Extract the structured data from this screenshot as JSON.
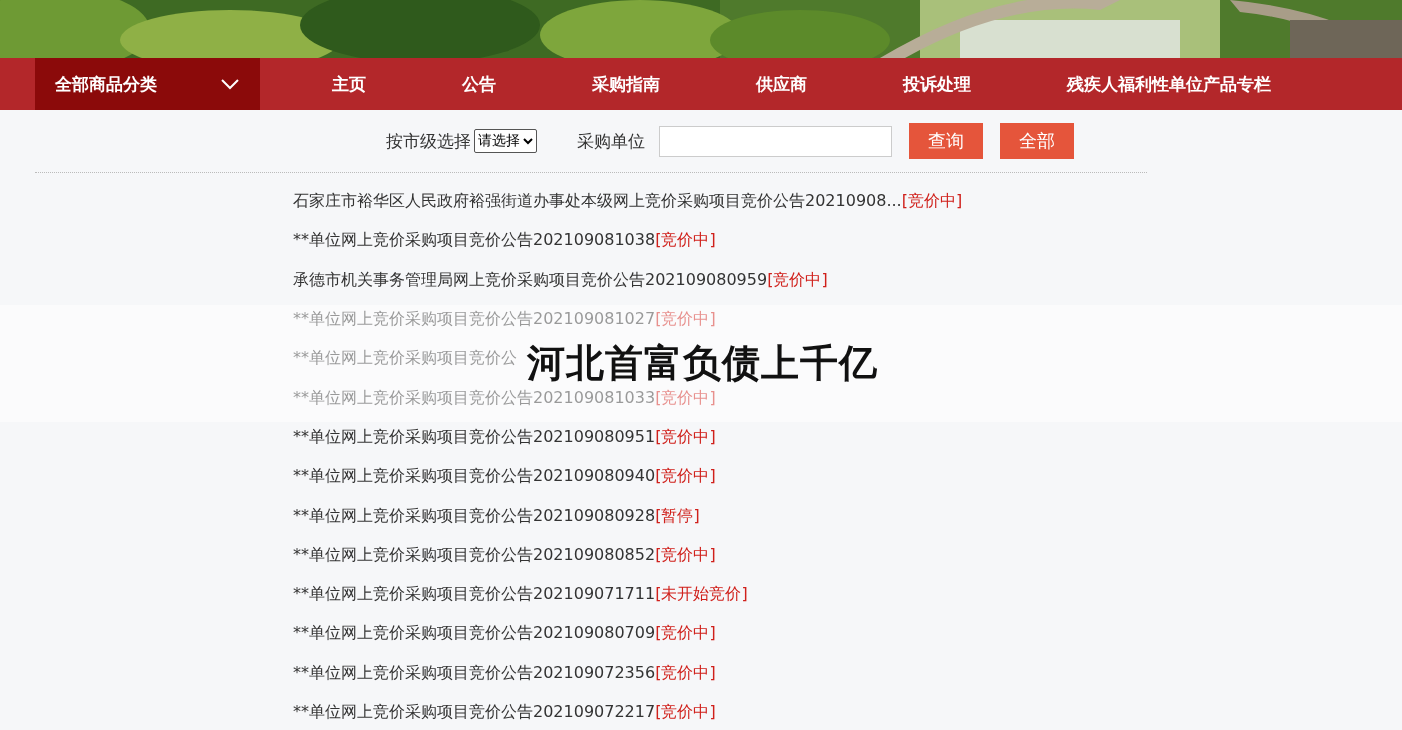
{
  "nav": {
    "category": {
      "label": "全部商品分类"
    },
    "items": [
      {
        "label": "主页"
      },
      {
        "label": "公告"
      },
      {
        "label": "采购指南"
      },
      {
        "label": "供应商"
      },
      {
        "label": "投诉处理"
      },
      {
        "label": "残疾人福利性单位产品专栏"
      }
    ]
  },
  "search": {
    "city_label": "按市级选择",
    "city_select": "请选择",
    "unit_label": "采购单位",
    "buttons": [
      "查询",
      "全部"
    ]
  },
  "notices": [
    {
      "title": "石家庄市裕华区人民政府裕强街道办事处本级网上竞价采购项目竞价公告20210908...",
      "status": "[竞价中]"
    },
    {
      "title": "**单位网上竞价采购项目竞价公告202109081038",
      "status": "[竞价中]"
    },
    {
      "title": "承德市机关事务管理局网上竞价采购项目竞价公告202109080959",
      "status": "[竞价中]"
    },
    {
      "title": "**单位网上竞价采购项目竞价公告202109081027",
      "status": "[竞价中]"
    },
    {
      "title": "**单位网上竞价采购项目竞价公"
    },
    {
      "title": "**单位网上竞价采购项目竞价公告202109081033",
      "status": "[竞价中]"
    },
    {
      "title": "**单位网上竞价采购项目竞价公告202109080951",
      "status": "[竞价中]"
    },
    {
      "title": "**单位网上竞价采购项目竞价公告202109080940",
      "status": "[竞价中]"
    },
    {
      "title": "**单位网上竞价采购项目竞价公告202109080928",
      "status": "[暂停]"
    },
    {
      "title": "**单位网上竞价采购项目竞价公告202109080852",
      "status": "[竞价中]"
    },
    {
      "title": "**单位网上竞价采购项目竞价公告202109071711",
      "status": "[未开始竞价]"
    },
    {
      "title": "**单位网上竞价采购项目竞价公告202109080709",
      "status": "[竞价中]"
    },
    {
      "title": "**单位网上竞价采购项目竞价公告202109072356",
      "status": "[竞价中]"
    },
    {
      "title": "**单位网上竞价采购项目竞价公告202109072217",
      "status": "[竞价中]"
    }
  ],
  "overlay": {
    "headline": "河北首富负债上千亿"
  }
}
